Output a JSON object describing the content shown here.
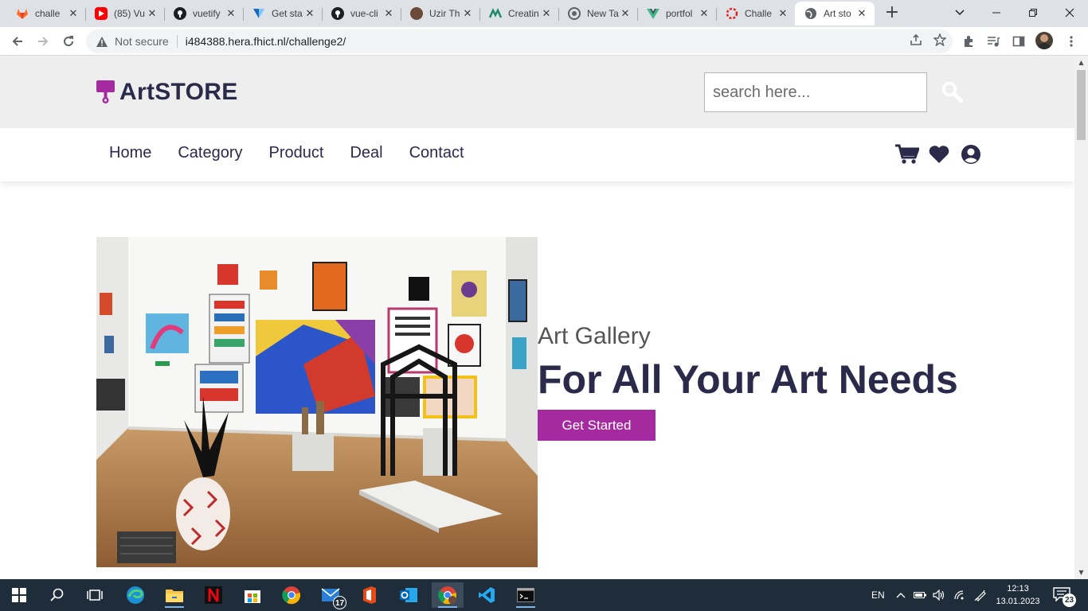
{
  "browser": {
    "tabs": [
      {
        "title": "challe",
        "icon": "gitlab-icon",
        "color": "#e24329"
      },
      {
        "title": "(85) Vu",
        "icon": "youtube-icon",
        "color": "#ff0000"
      },
      {
        "title": "vuetify",
        "icon": "github-icon",
        "color": "#1b1f23"
      },
      {
        "title": "Get sta",
        "icon": "vuetify-icon",
        "color": "#1867c0"
      },
      {
        "title": "vue-cli",
        "icon": "github-icon",
        "color": "#1b1f23"
      },
      {
        "title": "Uzir Th",
        "icon": "avatar-icon",
        "color": "#6b4a3a"
      },
      {
        "title": "Creatin",
        "icon": "mobirise-icon",
        "color": "#1e8a6a"
      },
      {
        "title": "New Ta",
        "icon": "chrome-icon",
        "color": "#5f6368"
      },
      {
        "title": "portfol",
        "icon": "vue-icon",
        "color": "#41b883"
      },
      {
        "title": "Challe",
        "icon": "canvas-icon",
        "color": "#e0261c"
      },
      {
        "title": "Art sto",
        "icon": "globe-icon",
        "color": "#5f6368"
      }
    ],
    "security_label": "Not secure",
    "url": "i484388.hera.fhict.nl/challenge2/"
  },
  "site": {
    "logo_text": "ArtSTORE",
    "brand_color": "#a52aa0",
    "text_color": "#2c2a4a",
    "search_placeholder": "search here...",
    "nav": [
      "Home",
      "Category",
      "Product",
      "Deal",
      "Contact"
    ],
    "header_icons": [
      "cart-icon",
      "heart-icon",
      "user-circle-icon"
    ],
    "hero": {
      "subtitle": "Art Gallery",
      "title": "For All Your Art Needs",
      "button": "Get Started"
    }
  },
  "taskbar": {
    "apps": [
      "start-icon",
      "search-icon",
      "task-view-icon",
      "edge-icon",
      "file-explorer-icon",
      "netflix-icon",
      "store-icon",
      "chrome-icon",
      "mail-icon",
      "office-icon",
      "outlook-icon",
      "chrome-profile-icon",
      "vscode-icon",
      "terminal-icon"
    ],
    "mail_badge": "17",
    "language": "EN",
    "time": "12:13",
    "date": "13.01.2023",
    "notification_count": "23"
  }
}
